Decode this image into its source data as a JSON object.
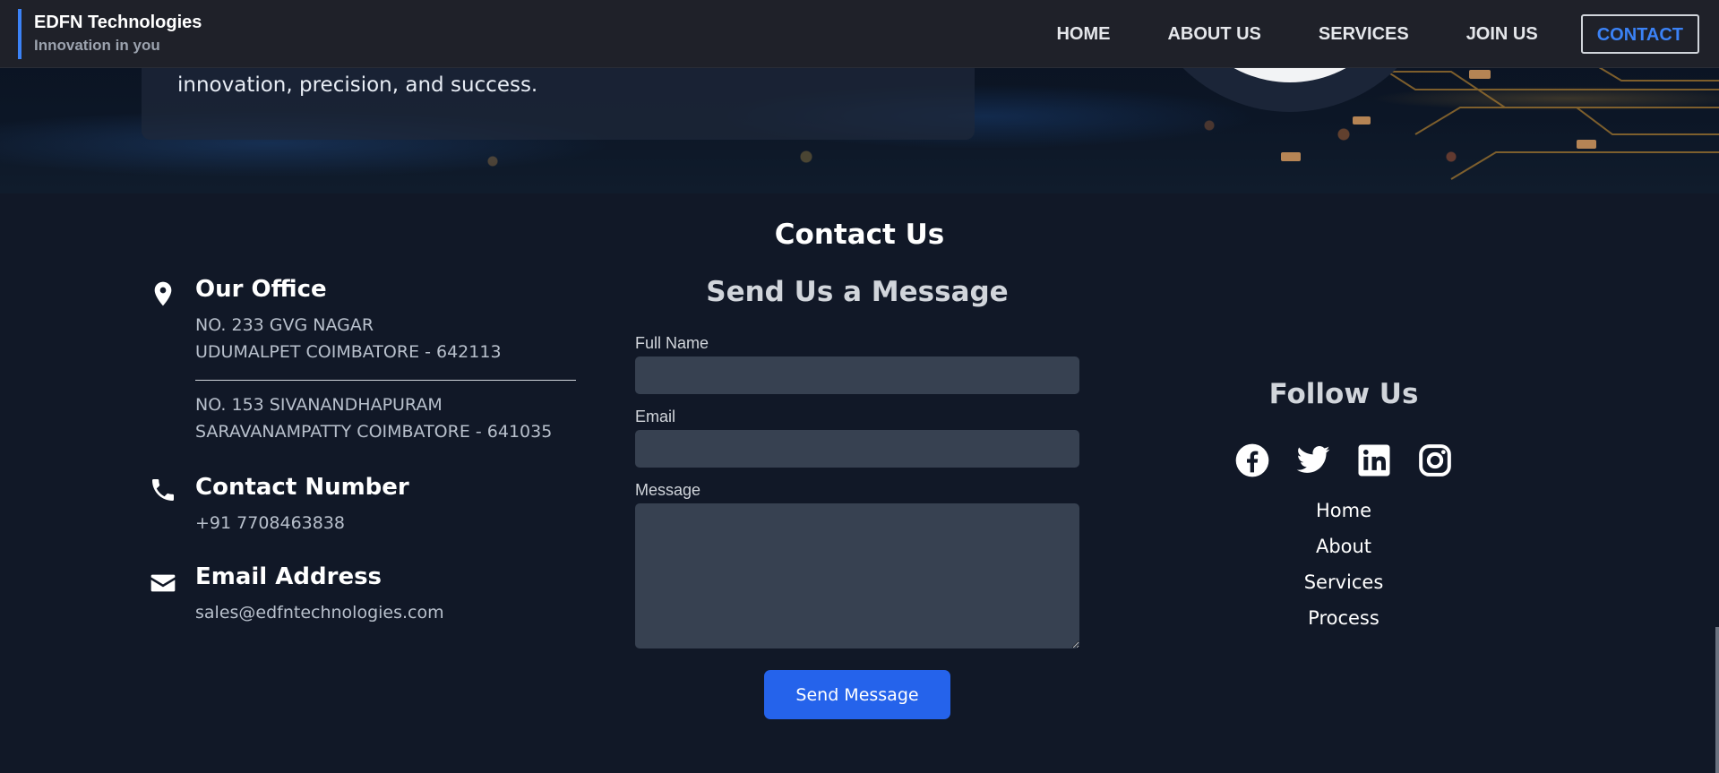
{
  "brand": {
    "name": "EDFN Technologies",
    "tagline": "Innovation in you"
  },
  "nav": {
    "items": [
      {
        "label": "HOME"
      },
      {
        "label": "ABOUT US"
      },
      {
        "label": "SERVICES"
      },
      {
        "label": "JOIN US"
      },
      {
        "label": "CONTACT",
        "active": true
      }
    ]
  },
  "hero": {
    "card_text": "innovation, precision, and success."
  },
  "contact": {
    "title": "Contact Us",
    "office": {
      "heading": "Our Office",
      "address1_line1": "NO. 233 GVG NAGAR",
      "address1_line2": "UDUMALPET COIMBATORE - 642113",
      "address2_line1": "NO. 153 SIVANANDHAPURAM",
      "address2_line2": "SARAVANAMPATTY COIMBATORE - 641035",
      "icon": "map-pin-icon"
    },
    "phone": {
      "heading": "Contact Number",
      "value": "+91 7708463838",
      "icon": "phone-icon"
    },
    "email": {
      "heading": "Email Address",
      "value": "sales@edfntechnologies.com",
      "icon": "envelope-icon"
    },
    "form": {
      "title": "Send Us a Message",
      "name_label": "Full Name",
      "name_value": "",
      "email_label": "Email",
      "email_value": "",
      "message_label": "Message",
      "message_value": "",
      "submit_label": "Send Message"
    },
    "follow": {
      "title": "Follow Us",
      "socials": [
        "facebook-icon",
        "twitter-icon",
        "linkedin-icon",
        "instagram-icon"
      ],
      "links": [
        {
          "label": "Home"
        },
        {
          "label": "About"
        },
        {
          "label": "Services"
        },
        {
          "label": "Process"
        }
      ]
    }
  },
  "colors": {
    "accent": "#2563eb",
    "nav_active": "#3b82f6",
    "background": "#111827",
    "input_bg": "#374151"
  }
}
